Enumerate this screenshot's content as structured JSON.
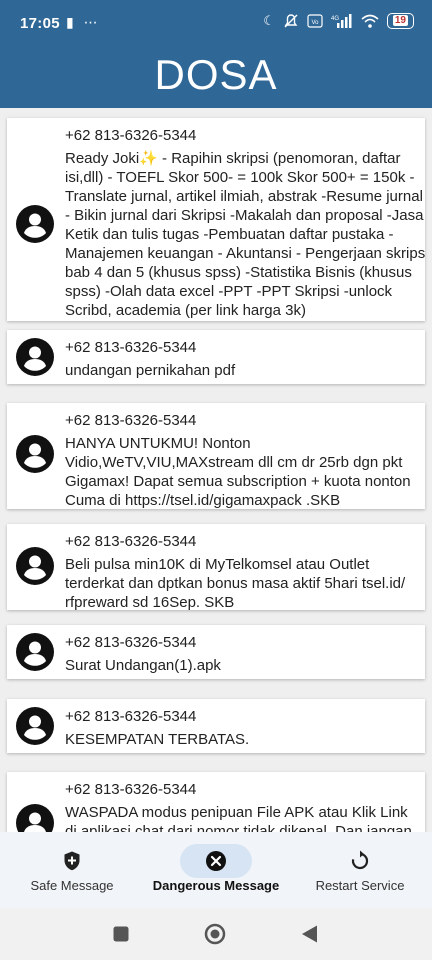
{
  "status_bar": {
    "time": "17:05",
    "battery": "19"
  },
  "app": {
    "title": "DOSA"
  },
  "messages": [
    {
      "sender": "+62 813-6326-5344",
      "lines": [
        "Ready Joki✨ - Rapihin skripsi (penomoran, daftar",
        "isi,dll) - TOEFL  Skor 500- = 100k Skor 500+ = 150k -",
        "Translate jurnal, artikel ilmiah, abstrak -Resume jurnal",
        "- Bikin jurnal dari Skripsi -Makalah dan proposal -Jasa",
        "Ketik dan tulis tugas -Pembuatan daftar pustaka -",
        "Manajemen keuangan - Akuntansi - Pengerjaan skripsi",
        "bab 4 dan 5 (khusus spss) -Statistika Bisnis (khusus",
        "spss) -Olah data excel -PPT -PPT Skripsi -unlock",
        "Scribd, academia (per link harga 3k)"
      ]
    },
    {
      "sender": "+62 813-6326-5344",
      "lines": [
        "undangan pernikahan pdf"
      ]
    },
    {
      "sender": "+62 813-6326-5344",
      "lines": [
        "HANYA UNTUKMU! Nonton",
        "Vidio,WeTV,VIU,MAXstream dll cm dr 25rb dgn pkt",
        "Gigamax! Dapat semua subscription + kuota nonton",
        "Cuma di https://tsel.id/gigamaxpack .SKB"
      ]
    },
    {
      "sender": "+62 813-6326-5344",
      "lines": [
        "Beli pulsa min10K di MyTelkomsel atau Outlet",
        "terderkat dan dptkan bonus masa aktif 5hari tsel.id/",
        "rfpreward sd 16Sep. SKB"
      ]
    },
    {
      "sender": "+62 813-6326-5344",
      "lines": [
        "Surat Undangan(1).apk"
      ]
    },
    {
      "sender": "+62 813-6326-5344",
      "lines": [
        "KESEMPATAN TERBATAS."
      ]
    },
    {
      "sender": "+62 813-6326-5344",
      "lines": [
        "WASPADA modus penipuan File APK atau Klik Link",
        "di aplikasi chat dari nomor tidak dikenal. Dan jangan"
      ]
    }
  ],
  "bottom_nav": [
    {
      "label": "Safe Message",
      "icon": "shield-plus-icon",
      "active": false
    },
    {
      "label": "Dangerous Message",
      "icon": "cancel-circle-icon",
      "active": true
    },
    {
      "label": "Restart Service",
      "icon": "restart-icon",
      "active": false
    }
  ],
  "colors": {
    "app_bar": "#2f6797",
    "active_pill": "#d6e4f3",
    "background": "#efefef"
  }
}
